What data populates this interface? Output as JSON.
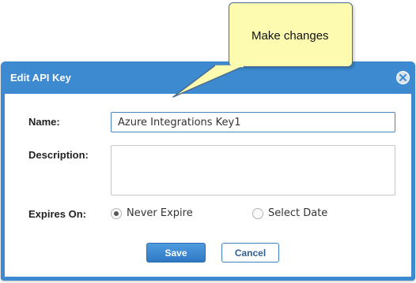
{
  "dialog": {
    "title": "Edit API Key"
  },
  "form": {
    "name_label": "Name:",
    "name_value": "Azure Integrations Key1",
    "description_label": "Description:",
    "description_value": "",
    "expires_label": "Expires On:",
    "expires_options": [
      {
        "label": "Never Expire",
        "selected": true
      },
      {
        "label": "Select Date",
        "selected": false
      }
    ]
  },
  "buttons": {
    "save": "Save",
    "cancel": "Cancel"
  },
  "callout": {
    "text": "Make changes"
  },
  "colors": {
    "accent": "#3d8ad0",
    "callout_bg": "#fdfbb0"
  },
  "icons": {
    "close": "close-icon",
    "radio": "radio-icon"
  }
}
